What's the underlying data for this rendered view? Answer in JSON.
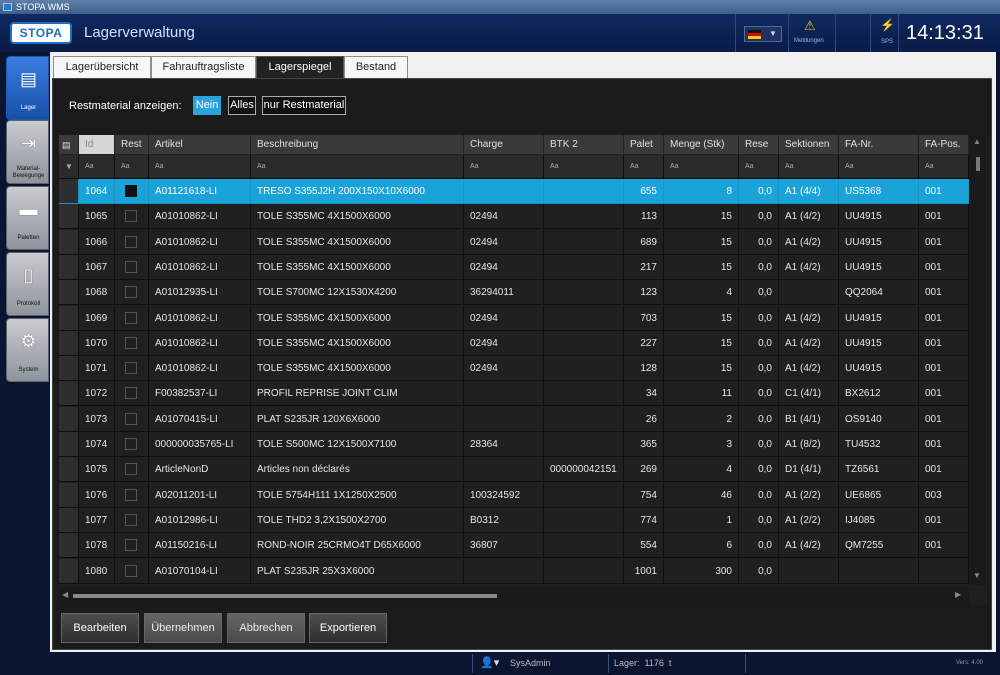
{
  "window": {
    "title": "STOPA WMS"
  },
  "header": {
    "logo": "STOPA",
    "title": "Lagerverwaltung",
    "language_flag": "de-flag-icon",
    "notifications_label": "Meldungen",
    "sps_label": "SPS",
    "clock": "14:13:31"
  },
  "nav": [
    {
      "label": "Lager",
      "icon": "warehouse-icon",
      "active": true
    },
    {
      "label": "Material-Bewegunge",
      "icon": "material-movement-icon",
      "active": false
    },
    {
      "label": "Paletten",
      "icon": "pallet-icon",
      "active": false
    },
    {
      "label": "Protokoll",
      "icon": "protocol-icon",
      "active": false
    },
    {
      "label": "System",
      "icon": "gear-icon",
      "active": false
    }
  ],
  "tabs": [
    {
      "label": "Lagerübersicht"
    },
    {
      "label": "Fahrauftragsliste"
    },
    {
      "label": "Lagerspiegel",
      "active": true
    },
    {
      "label": "Bestand"
    }
  ],
  "filter": {
    "label": "Restmaterial anzeigen:",
    "options": [
      "Nein",
      "Alles",
      "nur Restmaterial"
    ],
    "selected": "Nein"
  },
  "grid": {
    "columns": [
      "Id",
      "Rest",
      "Artikel",
      "Beschreibung",
      "Charge",
      "BTK 2",
      "Palet",
      "Menge (Stk)",
      "Rese",
      "Sektionen",
      "FA-Nr.",
      "FA-Pos."
    ],
    "filter_placeholder": "Aa",
    "rows": [
      {
        "id": "1064",
        "rest": true,
        "artikel": "A01121618-LI",
        "beschreibung": "TRESO S355J2H 200X150X10X6000",
        "charge": "",
        "btk2": "",
        "palet": "655",
        "menge": "8",
        "rese": "0,0",
        "sektionen": "A1 (4/4)",
        "fanr": "US5368",
        "fapos": "001",
        "selected": true
      },
      {
        "id": "1065",
        "rest": false,
        "artikel": "A01010862-LI",
        "beschreibung": "TOLE S355MC 4X1500X6000",
        "charge": "02494",
        "btk2": "",
        "palet": "113",
        "menge": "15",
        "rese": "0,0",
        "sektionen": "A1 (4/2)",
        "fanr": "UU4915",
        "fapos": "001"
      },
      {
        "id": "1066",
        "rest": false,
        "artikel": "A01010862-LI",
        "beschreibung": "TOLE S355MC 4X1500X6000",
        "charge": "02494",
        "btk2": "",
        "palet": "689",
        "menge": "15",
        "rese": "0,0",
        "sektionen": "A1 (4/2)",
        "fanr": "UU4915",
        "fapos": "001"
      },
      {
        "id": "1067",
        "rest": false,
        "artikel": "A01010862-LI",
        "beschreibung": "TOLE S355MC 4X1500X6000",
        "charge": "02494",
        "btk2": "",
        "palet": "217",
        "menge": "15",
        "rese": "0,0",
        "sektionen": "A1 (4/2)",
        "fanr": "UU4915",
        "fapos": "001"
      },
      {
        "id": "1068",
        "rest": false,
        "artikel": "A01012935-LI",
        "beschreibung": "TOLE S700MC 12X1530X4200",
        "charge": "36294011",
        "btk2": "",
        "palet": "123",
        "menge": "4",
        "rese": "0,0",
        "sektionen": "",
        "fanr": "QQ2064",
        "fapos": "001"
      },
      {
        "id": "1069",
        "rest": false,
        "artikel": "A01010862-LI",
        "beschreibung": "TOLE S355MC 4X1500X6000",
        "charge": "02494",
        "btk2": "",
        "palet": "703",
        "menge": "15",
        "rese": "0,0",
        "sektionen": "A1 (4/2)",
        "fanr": "UU4915",
        "fapos": "001"
      },
      {
        "id": "1070",
        "rest": false,
        "artikel": "A01010862-LI",
        "beschreibung": "TOLE S355MC 4X1500X6000",
        "charge": "02494",
        "btk2": "",
        "palet": "227",
        "menge": "15",
        "rese": "0,0",
        "sektionen": "A1 (4/2)",
        "fanr": "UU4915",
        "fapos": "001"
      },
      {
        "id": "1071",
        "rest": false,
        "artikel": "A01010862-LI",
        "beschreibung": "TOLE S355MC 4X1500X6000",
        "charge": "02494",
        "btk2": "",
        "palet": "128",
        "menge": "15",
        "rese": "0,0",
        "sektionen": "A1 (4/2)",
        "fanr": "UU4915",
        "fapos": "001"
      },
      {
        "id": "1072",
        "rest": false,
        "artikel": "F00382537-LI",
        "beschreibung": "PROFIL REPRISE JOINT CLIM",
        "charge": "",
        "btk2": "",
        "palet": "34",
        "menge": "11",
        "rese": "0,0",
        "sektionen": "C1 (4/1)",
        "fanr": "BX2612",
        "fapos": "001"
      },
      {
        "id": "1073",
        "rest": false,
        "artikel": "A01070415-LI",
        "beschreibung": "PLAT S235JR 120X6X6000",
        "charge": "",
        "btk2": "",
        "palet": "26",
        "menge": "2",
        "rese": "0,0",
        "sektionen": "B1 (4/1)",
        "fanr": "OS9140",
        "fapos": "001"
      },
      {
        "id": "1074",
        "rest": false,
        "artikel": "000000035765-LI",
        "beschreibung": "TOLE S500MC 12X1500X7100",
        "charge": "28364",
        "btk2": "",
        "palet": "365",
        "menge": "3",
        "rese": "0,0",
        "sektionen": "A1 (8/2)",
        "fanr": "TU4532",
        "fapos": "001"
      },
      {
        "id": "1075",
        "rest": false,
        "artikel": "ArticleNonD",
        "beschreibung": "Articles non déclarés",
        "charge": "",
        "btk2": "000000042151",
        "palet": "269",
        "menge": "4",
        "rese": "0,0",
        "sektionen": "D1 (4/1)",
        "fanr": "TZ6561",
        "fapos": "001"
      },
      {
        "id": "1076",
        "rest": false,
        "artikel": "A02011201-LI",
        "beschreibung": "TOLE 5754H111 1X1250X2500",
        "charge": "100324592",
        "btk2": "",
        "palet": "754",
        "menge": "46",
        "rese": "0,0",
        "sektionen": "A1 (2/2)",
        "fanr": "UE6865",
        "fapos": "003"
      },
      {
        "id": "1077",
        "rest": false,
        "artikel": "A01012986-LI",
        "beschreibung": "TOLE THD2 3,2X1500X2700",
        "charge": "B0312",
        "btk2": "",
        "palet": "774",
        "menge": "1",
        "rese": "0,0",
        "sektionen": "A1 (2/2)",
        "fanr": "IJ4085",
        "fapos": "001"
      },
      {
        "id": "1078",
        "rest": false,
        "artikel": "A01150216-LI",
        "beschreibung": "ROND-NOIR 25CRMO4T D65X6000",
        "charge": "36807",
        "btk2": "",
        "palet": "554",
        "menge": "6",
        "rese": "0,0",
        "sektionen": "A1 (4/2)",
        "fanr": "QM7255",
        "fapos": "001"
      },
      {
        "id": "1080",
        "rest": false,
        "artikel": "A01070104-LI",
        "beschreibung": "PLAT S235JR 25X3X6000",
        "charge": "",
        "btk2": "",
        "palet": "1001",
        "menge": "300",
        "rese": "0,0",
        "sektionen": "",
        "fanr": "",
        "fapos": ""
      }
    ]
  },
  "actions": [
    {
      "label": "Bearbeiten"
    },
    {
      "label": "Übernehmen"
    },
    {
      "label": "Abbrechen"
    },
    {
      "label": "Exportieren"
    }
  ],
  "status": {
    "user": "SysAdmin",
    "lager_label": "Lager:",
    "lager_value": "1176",
    "lager_unit": "t",
    "version": "Vers: 4.00"
  },
  "colors": {
    "accent": "#1aa3d9",
    "header": "#0f2a62"
  }
}
